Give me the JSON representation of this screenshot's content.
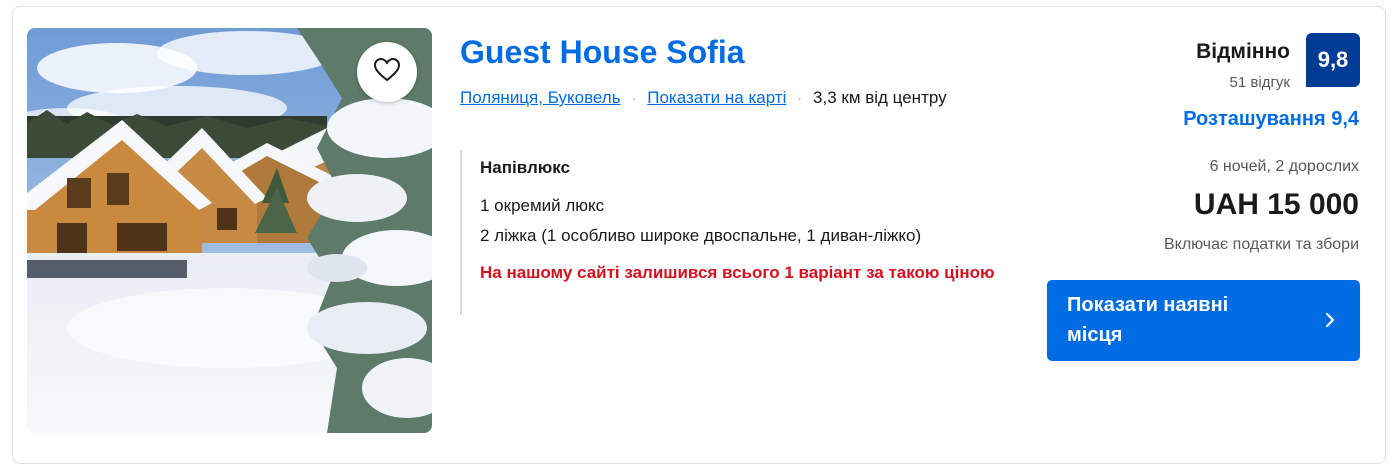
{
  "property": {
    "name": "Guest House Sofia",
    "location_link": "Поляниця, Буковель",
    "map_link": "Показати на карті",
    "separator": "·",
    "distance": "3,3 км від центру"
  },
  "room": {
    "name": "Напівлюкс",
    "units": "1 окремий люкс",
    "beds": "2 ліжка (1 особливо широке двоспальне, 1 диван-ліжко)",
    "scarcity": "На нашому сайті залишився всього 1 варіант за такою ціною"
  },
  "rating": {
    "word": "Відмінно",
    "reviews": "51 відгук",
    "score": "9,8",
    "location_score": "Розташування 9,4"
  },
  "pricing": {
    "stay": "6 ночей, 2 дорослих",
    "price": "UAH 15 000",
    "taxes": "Включає податки та збори"
  },
  "cta": {
    "label": "Показати наявні місця"
  },
  "icons": {
    "favorite": "heart-outline-icon",
    "chevron": "chevron-right-icon"
  },
  "colors": {
    "link": "#006ce4",
    "score_badge": "#003b95",
    "scarcity": "#d4111e",
    "button": "#006ce4"
  }
}
